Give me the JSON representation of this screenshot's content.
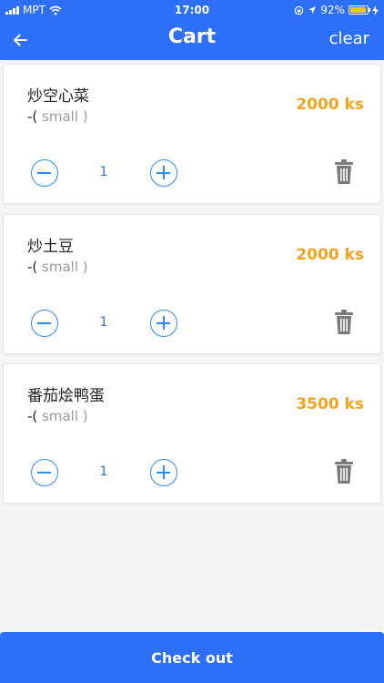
{
  "status_bar": {
    "carrier": "MPT",
    "time": "17:00",
    "battery_percent": "92%",
    "battery_level": 0.92
  },
  "header": {
    "back_icon": "arrow-left-icon",
    "title": "Cart",
    "clear_label": "clear"
  },
  "cart_items": [
    {
      "name": "炒空心菜",
      "size_prefix": "-(",
      "size_option": " small ",
      "size_suffix": ")",
      "price": "2000 ks",
      "quantity": "1"
    },
    {
      "name": "炒土豆",
      "size_prefix": "-(",
      "size_option": " small ",
      "size_suffix": ")",
      "price": "2000 ks",
      "quantity": "1"
    },
    {
      "name": "番茄烩鸭蛋",
      "size_prefix": "-(",
      "size_option": " small ",
      "size_suffix": ")",
      "price": "3500 ks",
      "quantity": "1"
    }
  ],
  "footer": {
    "checkout_label": "Check out"
  },
  "colors": {
    "primary": "#2d6ff7",
    "price": "#f5a31a",
    "stepper": "#2e8cf0"
  }
}
